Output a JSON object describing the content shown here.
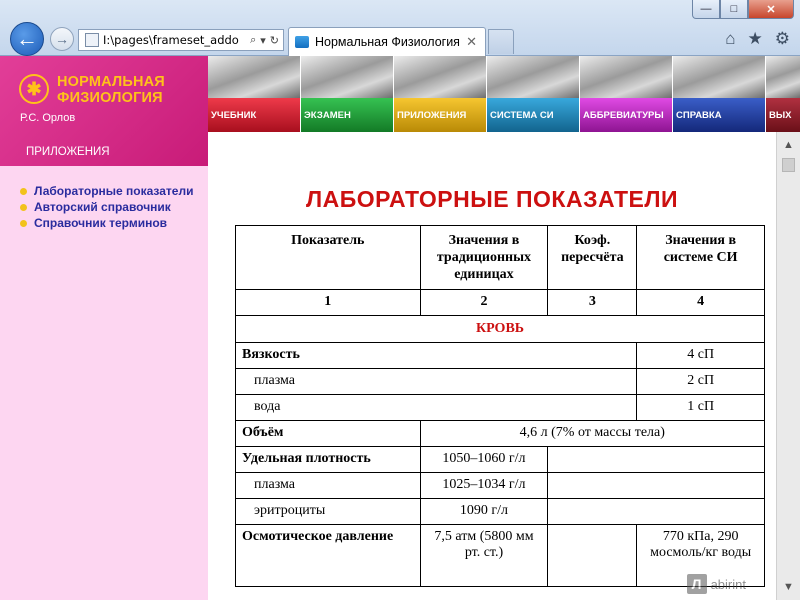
{
  "browser": {
    "address": "I:\\pages\\frameset_addo",
    "search_glyph": "⌕",
    "dropdown_glyph": "▾",
    "refresh_glyph": "↻",
    "tab_title": "Нормальная Физиология",
    "tab_close": "✕",
    "min_glyph": "—",
    "max_glyph": "□",
    "close_glyph": "✕",
    "back_glyph": "←",
    "forward_glyph": "→",
    "home_glyph": "⌂",
    "star_glyph": "★",
    "gear_glyph": "⚙"
  },
  "sidebar": {
    "logo_line1": "НОРМАЛЬНАЯ",
    "logo_line2": "ФИЗИОЛОГИЯ",
    "author": "Р.С. Орлов",
    "section": "ПРИЛОЖЕНИЯ",
    "links": [
      "Лабораторные показатели",
      "Авторский справочник",
      "Справочник терминов"
    ]
  },
  "banner": {
    "items": [
      {
        "label": "УЧЕБНИК",
        "color": "#d1172a"
      },
      {
        "label": "ЭКЗАМЕН",
        "color": "#1a9a34"
      },
      {
        "label": "ПРИЛОЖЕНИЯ",
        "color": "#e0a810"
      },
      {
        "label": "СИСТЕМА СИ",
        "color": "#1a84b8"
      },
      {
        "label": "АББРЕВИАТУРЫ",
        "color": "#c02cc4"
      },
      {
        "label": "СПРАВКА",
        "color": "#1e3fa0"
      },
      {
        "label": "ВЫХ",
        "color": "#8a1a24"
      }
    ]
  },
  "page": {
    "title": "ЛАБОРАТОРНЫЕ ПОКАЗАТЕЛИ"
  },
  "table": {
    "headers": [
      "Показатель",
      "Значения в традиционных единицах",
      "Коэф. пересчёта",
      "Значения в системе СИ"
    ],
    "numbers": [
      "1",
      "2",
      "3",
      "4"
    ],
    "section": "КРОВЬ",
    "rows": {
      "viscosity": {
        "label": "Вязкость",
        "si": "4 сП"
      },
      "plasma_visc": {
        "label": "плазма",
        "si": "2 сП"
      },
      "water": {
        "label": "вода",
        "si": "1 сП"
      },
      "volume": {
        "label": "Объём",
        "value": "4,6 л (7% от массы тела)"
      },
      "density": {
        "label": "Удельная плотность",
        "trad": "1050–1060 г/л"
      },
      "plasma_dens": {
        "label": "плазма",
        "trad": "1025–1034 г/л"
      },
      "erythrocytes": {
        "label": "эритроциты",
        "trad": "1090 г/л"
      },
      "osmotic": {
        "label": "Осмотическое давление",
        "trad": "7,5 атм (5800 мм рт. ст.)",
        "si": "770 кПа, 290 мосмоль/кг воды"
      }
    }
  },
  "scroll": {
    "up": "▲",
    "down": "▼"
  },
  "watermark": {
    "mark": "Л",
    "text": "abirint"
  }
}
